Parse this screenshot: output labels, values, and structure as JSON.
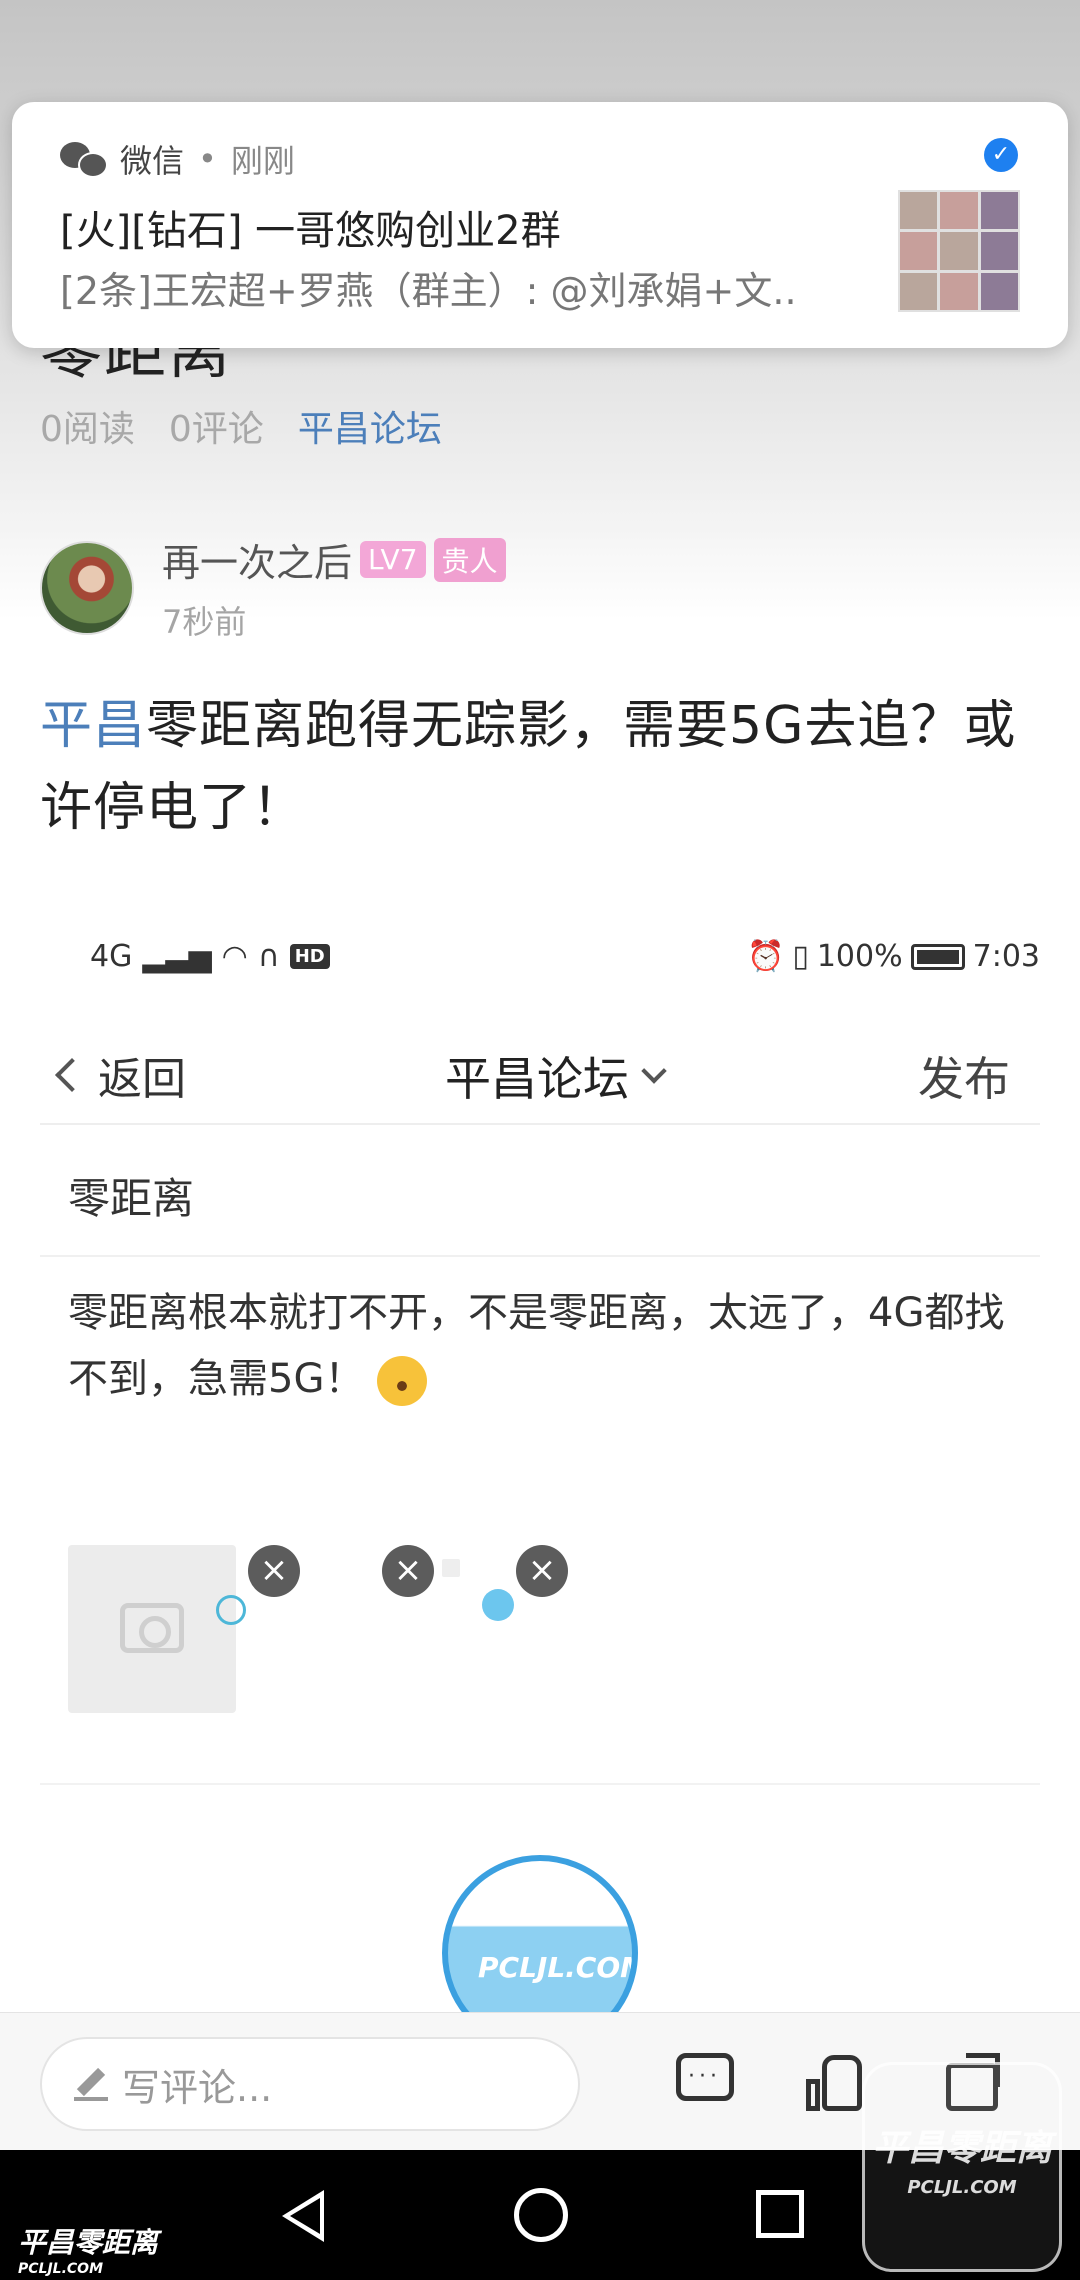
{
  "notification": {
    "app_name": "微信",
    "separator": "•",
    "time": "刚刚",
    "title": "[火][钻石]  一哥悠购创业2群",
    "body": "[2条]王宏超+罗燕（群主）: @刘承娟+文..",
    "verified_icon": "check-shield-icon"
  },
  "article": {
    "title": "零距离",
    "reads": "0阅读",
    "comments": "0评论",
    "forum": "平昌论坛"
  },
  "author": {
    "name": "再一次之后",
    "level": "LV7",
    "rank": "贵人",
    "time": "7秒前"
  },
  "post": {
    "tag": "平昌",
    "text": "零距离跑得无踪影，需要5G去追？或许停电了！"
  },
  "embedded": {
    "status": {
      "network": "4G",
      "hd": "HD",
      "battery": "100%",
      "time": "7:03"
    },
    "nav": {
      "back_label": "返回",
      "forum_label": "平昌论坛",
      "publish_label": "发布"
    },
    "subject": "零距离",
    "body": "零距离根本就打不开，不是零距离，太远了，4G都找不到，急需5G！",
    "logo_text": "平昌",
    "logo_url": "PCLJL.COM"
  },
  "action_bar": {
    "comment_placeholder": "写评论...",
    "icons": [
      "comments-icon",
      "like-icon",
      "share-icon"
    ]
  },
  "watermark": {
    "name": "平昌零距离",
    "url": "PCLJL.COM"
  }
}
